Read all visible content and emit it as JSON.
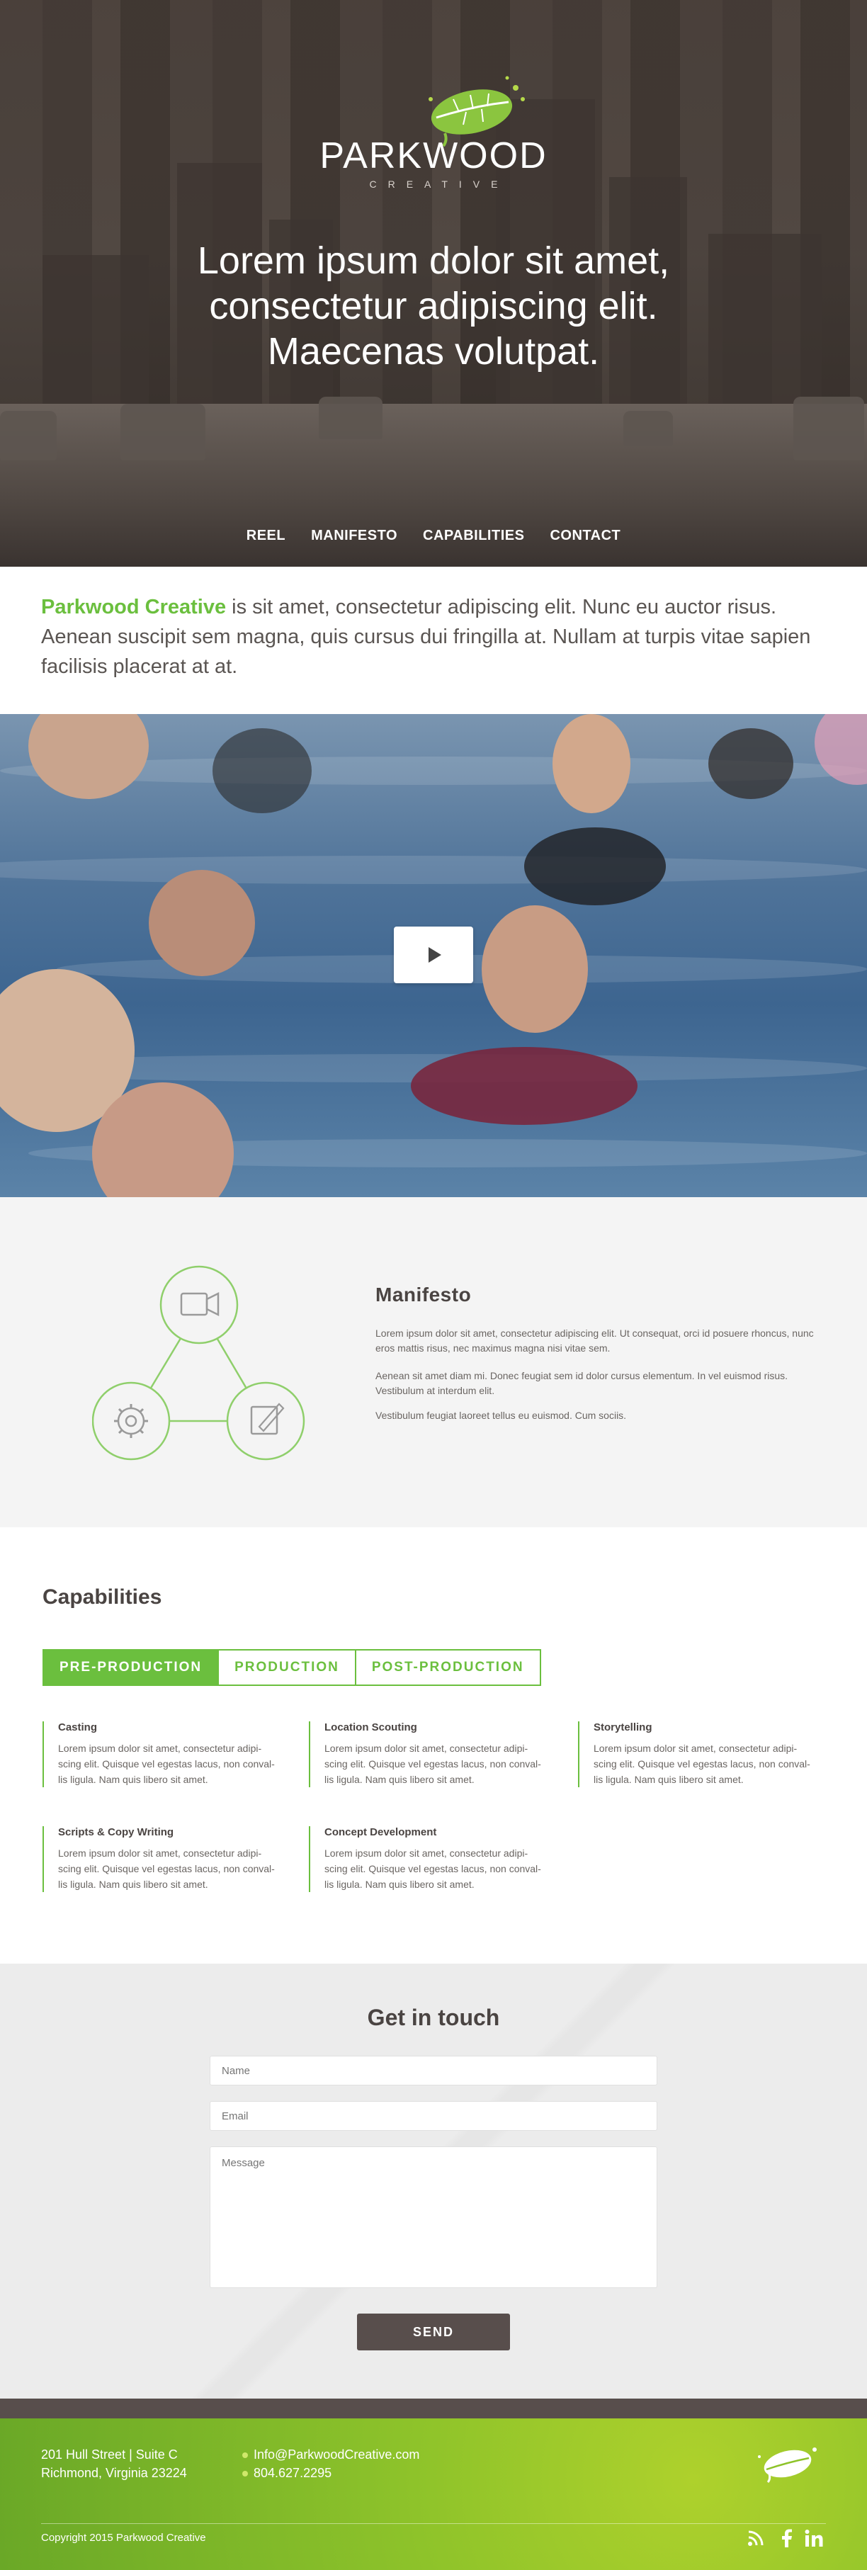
{
  "hero": {
    "logo_name": "PARKWOOD",
    "logo_sub": "CREATIVE",
    "title_lines": [
      "Lorem ipsum dolor sit amet,",
      "consectetur adipiscing elit.",
      "Maecenas volutpat."
    ]
  },
  "nav": {
    "items": [
      {
        "label": "REEL"
      },
      {
        "label": "MANIFESTO"
      },
      {
        "label": "CAPABILITIES"
      },
      {
        "label": "CONTACT"
      }
    ]
  },
  "intro": {
    "brand": "Parkwood Creative",
    "text": " is sit amet, consectetur adipiscing elit. Nunc eu auctor risus. Aenean suscipit sem magna, quis cursus dui fringilla at. Nullam at turpis vitae sapien facilisis placerat at at."
  },
  "manifesto": {
    "title": "Manifesto",
    "paragraphs": [
      "Lorem ipsum dolor sit amet, consectetur adipiscing elit. Ut consequat, orci id posuere rhoncus, nunc eros mattis risus, nec maximus magna nisi vitae sem.",
      "Aenean sit amet diam mi. Donec feugiat sem id dolor cursus elementum. In vel euismod risus. Vestibulum at interdum elit.",
      "Vestibulum feugiat laoreet tellus eu euismod. Cum sociis."
    ]
  },
  "capabilities": {
    "title": "Capabilities",
    "tabs": [
      {
        "label": "PRE-PRODUCTION"
      },
      {
        "label": "PRODUCTION"
      },
      {
        "label": "POST-PRODUCTION"
      }
    ],
    "items": [
      {
        "title": "Casting",
        "text": "Lorem ipsum dolor sit amet, consectetur adipi-scing elit. Quisque vel egestas lacus, non conval-lis ligula. Nam quis libero sit amet."
      },
      {
        "title": "Location Scouting",
        "text": "Lorem ipsum dolor sit amet, consectetur adipi-scing elit. Quisque vel egestas lacus, non conval-lis ligula. Nam quis libero sit amet."
      },
      {
        "title": "Storytelling",
        "text": "Lorem ipsum dolor sit amet, consectetur adipi-scing elit. Quisque vel egestas lacus, non conval-lis ligula. Nam quis libero sit amet."
      },
      {
        "title": "Scripts & Copy Writing",
        "text": "Lorem ipsum dolor sit amet, consectetur adipi-scing elit. Quisque vel egestas lacus, non conval-lis ligula. Nam quis libero sit amet."
      },
      {
        "title": "Concept Development",
        "text": "Lorem ipsum dolor sit amet, consectetur adipi-scing elit. Quisque vel egestas lacus, non conval-lis ligula. Nam quis libero sit amet."
      }
    ]
  },
  "contact": {
    "title": "Get in touch",
    "name_placeholder": "Name",
    "email_placeholder": "Email",
    "message_placeholder": "Message",
    "send_label": "SEND"
  },
  "footer": {
    "address_line1": "201 Hull Street | Suite C",
    "address_line2": "Richmond, Virginia 23224",
    "email": "Info@ParkwoodCreative.com",
    "phone": "804.627.2295",
    "copyright": "Copyright 2015 Parkwood Creative",
    "social": [
      "rss-icon",
      "facebook-icon",
      "linkedin-icon"
    ]
  },
  "colors": {
    "accent": "#6bbf3e",
    "dark": "#584e4c",
    "footer_green": "#8ec32a"
  }
}
